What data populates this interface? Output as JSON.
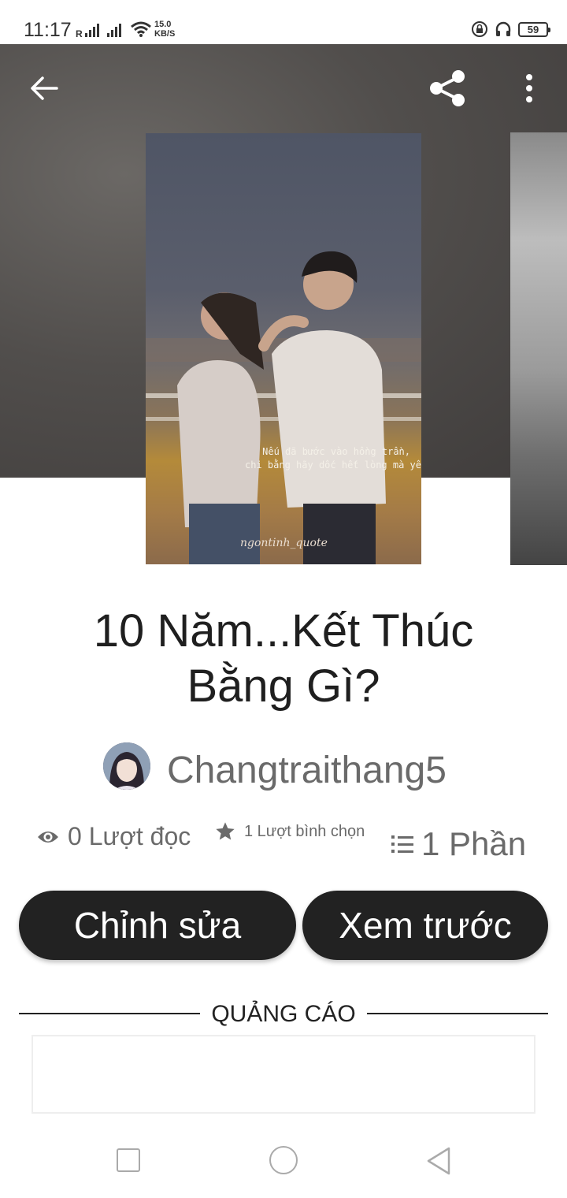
{
  "status_bar": {
    "time": "11:17",
    "signal_label": "R",
    "net_speed": "15.0",
    "net_unit": "KB/S",
    "battery": "59"
  },
  "header": {
    "back_icon": "arrow-left-icon",
    "share_icon": "share-icon",
    "more_icon": "more-vertical-icon"
  },
  "cover": {
    "text_line1": "Nếu đã bước vào hồng trần,",
    "text_line2": "chi bằng hãy dốc hết lòng mà yê",
    "signature": "ngontinh_quote"
  },
  "story": {
    "title_line1": "10 Năm...Kết Thúc",
    "title_line2": "Bằng Gì?",
    "author": "Changtraithang5"
  },
  "stats": {
    "reads": "0 Lượt đọc",
    "votes": "1 Lượt bình chọn",
    "parts": "1 Phần"
  },
  "actions": {
    "edit": "Chỉnh sửa",
    "preview": "Xem trước"
  },
  "ad": {
    "label": "QUẢNG CÁO"
  },
  "colors": {
    "button_bg": "#222222",
    "header_bg": "#514e4c",
    "muted_text": "#6a6a6a"
  }
}
